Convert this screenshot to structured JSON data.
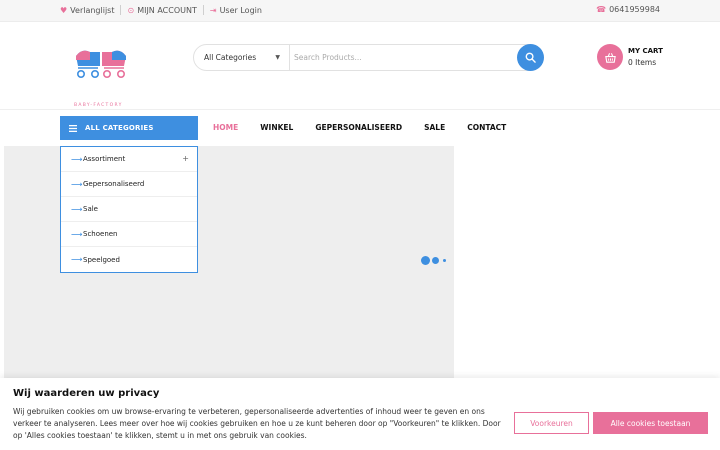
{
  "topbar": {
    "wishlist": "Verlanglijst",
    "account": "MIJN ACCOUNT",
    "login": "User Login",
    "phone": "0641959984"
  },
  "header": {
    "logo_text": "BABY-FACTORY",
    "category_select": "All Categories",
    "search_placeholder": "Search Products...",
    "cart_title": "MY CART",
    "cart_count": "0 Items"
  },
  "nav": {
    "all_categories": "ALL CATEGORIES",
    "items": [
      {
        "label": "HOME",
        "active": true
      },
      {
        "label": "WINKEL",
        "active": false
      },
      {
        "label": "GEPERSONALISEERD",
        "active": false
      },
      {
        "label": "SALE",
        "active": false
      },
      {
        "label": "CONTACT",
        "active": false
      }
    ]
  },
  "category_menu": [
    {
      "label": "Assortiment",
      "expand": "+"
    },
    {
      "label": "Gepersonaliseerd",
      "expand": ""
    },
    {
      "label": "Sale",
      "expand": ""
    },
    {
      "label": "Schoenen",
      "expand": ""
    },
    {
      "label": "Speelgoed",
      "expand": ""
    }
  ],
  "cookie": {
    "title": "Wij waarderen uw privacy",
    "text": "Wij gebruiken cookies om uw browse-ervaring te verbeteren, gepersonaliseerde advertenties of inhoud weer te geven en ons verkeer te analyseren. Lees meer over hoe wij cookies gebruiken en hoe u ze kunt beheren door op \"Voorkeuren\" te klikken. Door op 'Alles cookies toestaan' te klikken, stemt u in met ons gebruik van cookies.",
    "preferences": "Voorkeuren",
    "allow_all": "Alle cookies toestaan"
  },
  "colors": {
    "accent_blue": "#3e8fe0",
    "accent_pink": "#e8709a"
  },
  "icons": {
    "wishlist": "heart-icon",
    "account": "user-circle-icon",
    "login": "login-icon",
    "phone": "phone-icon",
    "search": "search-icon",
    "cart": "basket-icon",
    "menu": "hamburger-icon",
    "category_arrow": "arrow-right-icon"
  }
}
